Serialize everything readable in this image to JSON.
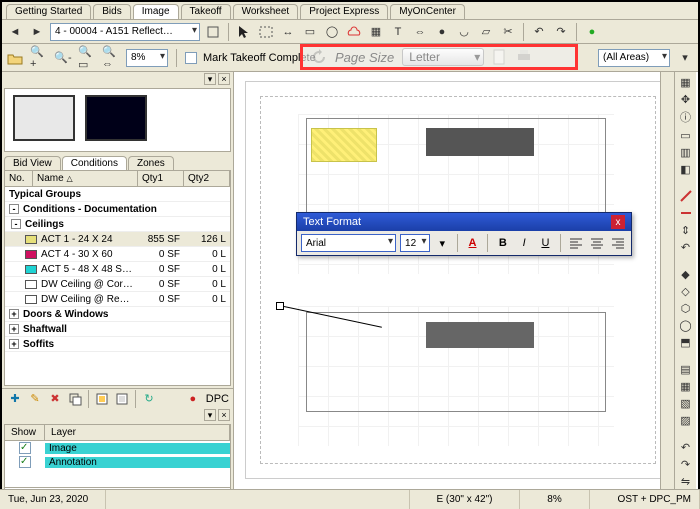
{
  "tabs_top": [
    "Getting Started",
    "Bids",
    "Image",
    "Takeoff",
    "Worksheet",
    "Project Express",
    "MyOnCenter"
  ],
  "tabs_top_active": 2,
  "page_combo": "4 - 00004 - A151 Reflect…",
  "mark_complete_label": "Mark Takeoff Complete",
  "page_size": {
    "label": "Page Size",
    "value": "Letter"
  },
  "areas_combo": "(All Areas)",
  "inner_tabs": [
    "Bid View",
    "Conditions",
    "Zones"
  ],
  "inner_tabs_active": 1,
  "grid_headers": {
    "no": "No.",
    "name": "Name",
    "qty1": "Qty1",
    "qty2": "Qty2"
  },
  "groups": {
    "typical": "Typical Groups",
    "cond_doc": "Conditions - Documentation",
    "ceilings": "Ceilings",
    "doors": "Doors & Windows",
    "shaft": "Shaftwall",
    "soffits": "Soffits"
  },
  "ceilings": [
    {
      "color": "#e6e07a",
      "name": "ACT 1 - 24 X 24",
      "q1": "855 SF",
      "q2": "126 L",
      "sel": true
    },
    {
      "color": "#d01060",
      "name": "ACT 4 - 30 X 60",
      "q1": "0 SF",
      "q2": "0 L"
    },
    {
      "color": "#1fd3d3",
      "name": "ACT 5 - 48 X 48 S…",
      "q1": "0 SF",
      "q2": "0 L"
    },
    {
      "color": "#ffffff",
      "name": "DW Ceiling @ Cor…",
      "q1": "0 SF",
      "q2": "0 L"
    },
    {
      "color": "#ffffff",
      "name": "DW Ceiling @ Re…",
      "q1": "0 SF",
      "q2": "0 L"
    }
  ],
  "dpc_label": "DPC",
  "layer_headers": {
    "show": "Show",
    "layer": "Layer"
  },
  "layers": [
    "Image",
    "Annotation"
  ],
  "text_format": {
    "title": "Text Format",
    "font": "Arial",
    "size": "12",
    "b": "B",
    "i": "I",
    "u": "U"
  },
  "status": {
    "date": "Tue, Jun 23, 2020",
    "sheet": "E (30\" x 42\")",
    "zoom": "8%",
    "mode": "OST + DPC_PM"
  },
  "pct": "8%"
}
